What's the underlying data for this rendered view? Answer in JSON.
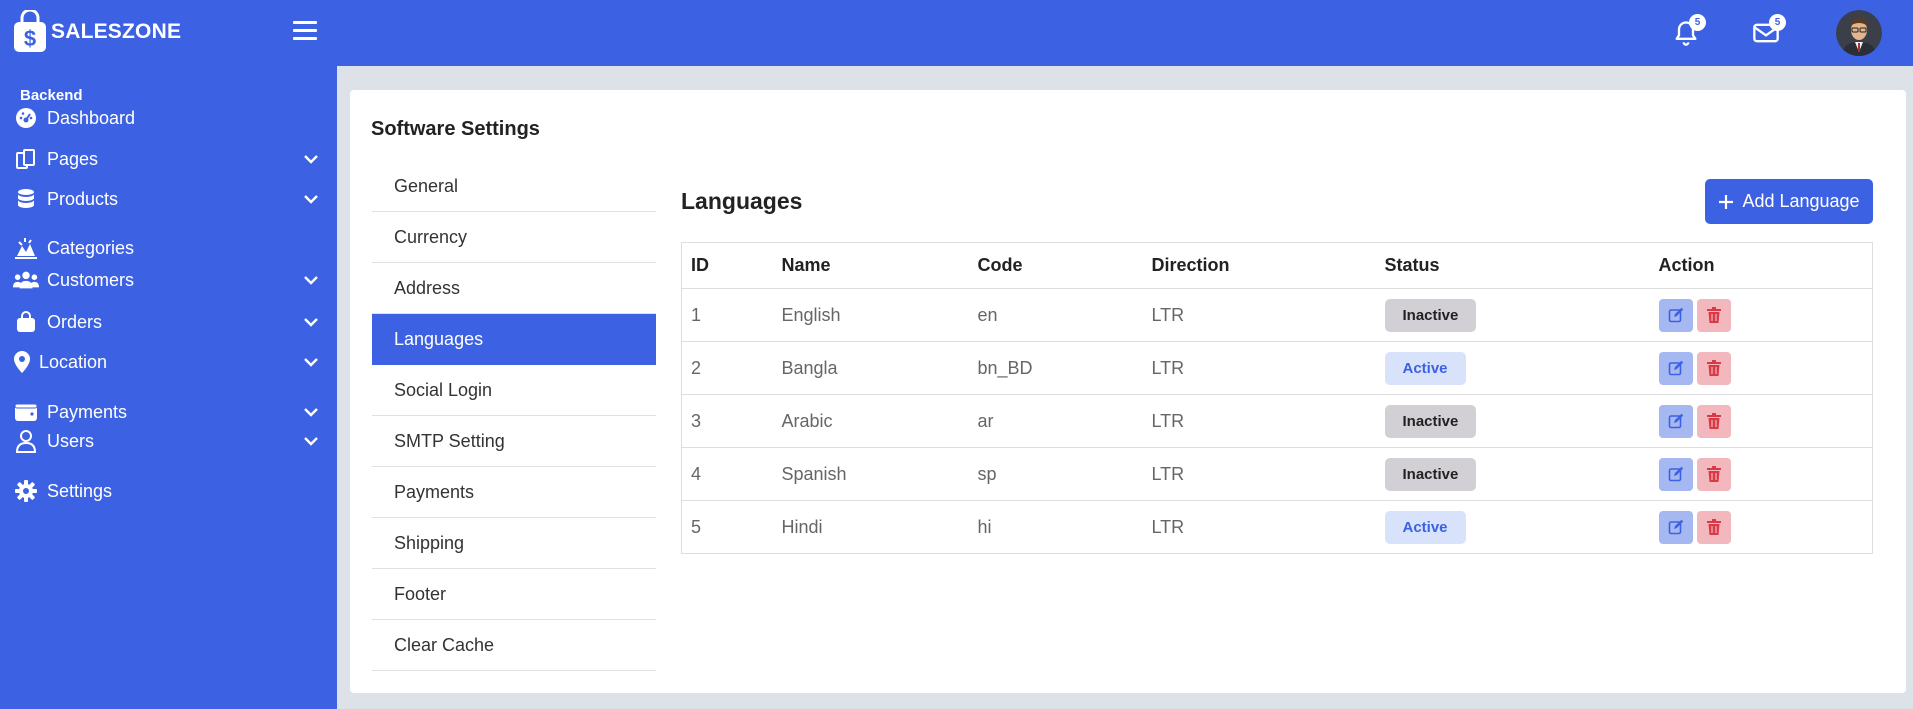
{
  "brand": {
    "name": "SALESZONE"
  },
  "header": {
    "notifications_count": "5",
    "messages_count": "5"
  },
  "sidebar": {
    "section": "Backend",
    "items": [
      {
        "label": "Dashboard",
        "icon": "dashboard-icon",
        "expandable": false
      },
      {
        "label": "Pages",
        "icon": "pages-icon",
        "expandable": true
      },
      {
        "label": "Products",
        "icon": "database-icon",
        "expandable": true
      },
      {
        "label": "Categories",
        "icon": "categories-icon",
        "expandable": false
      },
      {
        "label": "Customers",
        "icon": "users-group-icon",
        "expandable": true
      },
      {
        "label": "Orders",
        "icon": "shopping-bag-icon",
        "expandable": true
      },
      {
        "label": "Location",
        "icon": "map-pin-icon",
        "expandable": true
      },
      {
        "label": "Payments",
        "icon": "wallet-icon",
        "expandable": true
      },
      {
        "label": "Users",
        "icon": "user-icon",
        "expandable": true
      },
      {
        "label": "Settings",
        "icon": "gear-icon",
        "expandable": false
      }
    ]
  },
  "main": {
    "title": "Software Settings",
    "settings_menu": [
      {
        "label": "General",
        "active": false
      },
      {
        "label": "Currency",
        "active": false
      },
      {
        "label": "Address",
        "active": false
      },
      {
        "label": "Languages",
        "active": true
      },
      {
        "label": "Social Login",
        "active": false
      },
      {
        "label": "SMTP Setting",
        "active": false
      },
      {
        "label": "Payments",
        "active": false
      },
      {
        "label": "Shipping",
        "active": false
      },
      {
        "label": "Footer",
        "active": false
      },
      {
        "label": "Clear Cache",
        "active": false
      }
    ],
    "panel": {
      "title": "Languages",
      "add_button": "Add Language",
      "columns": [
        "ID",
        "Name",
        "Code",
        "Direction",
        "Status",
        "Action"
      ],
      "rows": [
        {
          "id": "1",
          "name": "English",
          "code": "en",
          "direction": "LTR",
          "status": "Inactive"
        },
        {
          "id": "2",
          "name": "Bangla",
          "code": "bn_BD",
          "direction": "LTR",
          "status": "Active"
        },
        {
          "id": "3",
          "name": "Arabic",
          "code": "ar",
          "direction": "LTR",
          "status": "Inactive"
        },
        {
          "id": "4",
          "name": "Spanish",
          "code": "sp",
          "direction": "LTR",
          "status": "Inactive"
        },
        {
          "id": "5",
          "name": "Hindi",
          "code": "hi",
          "direction": "LTR",
          "status": "Active"
        }
      ]
    }
  },
  "colors": {
    "primary": "#3c61e3",
    "inactive_badge": "#d2d0d5",
    "active_badge": "#d8e2fb",
    "edit_button": "#a6b8f2",
    "delete_button": "#f2b8bd",
    "delete_icon": "#d93a47"
  }
}
